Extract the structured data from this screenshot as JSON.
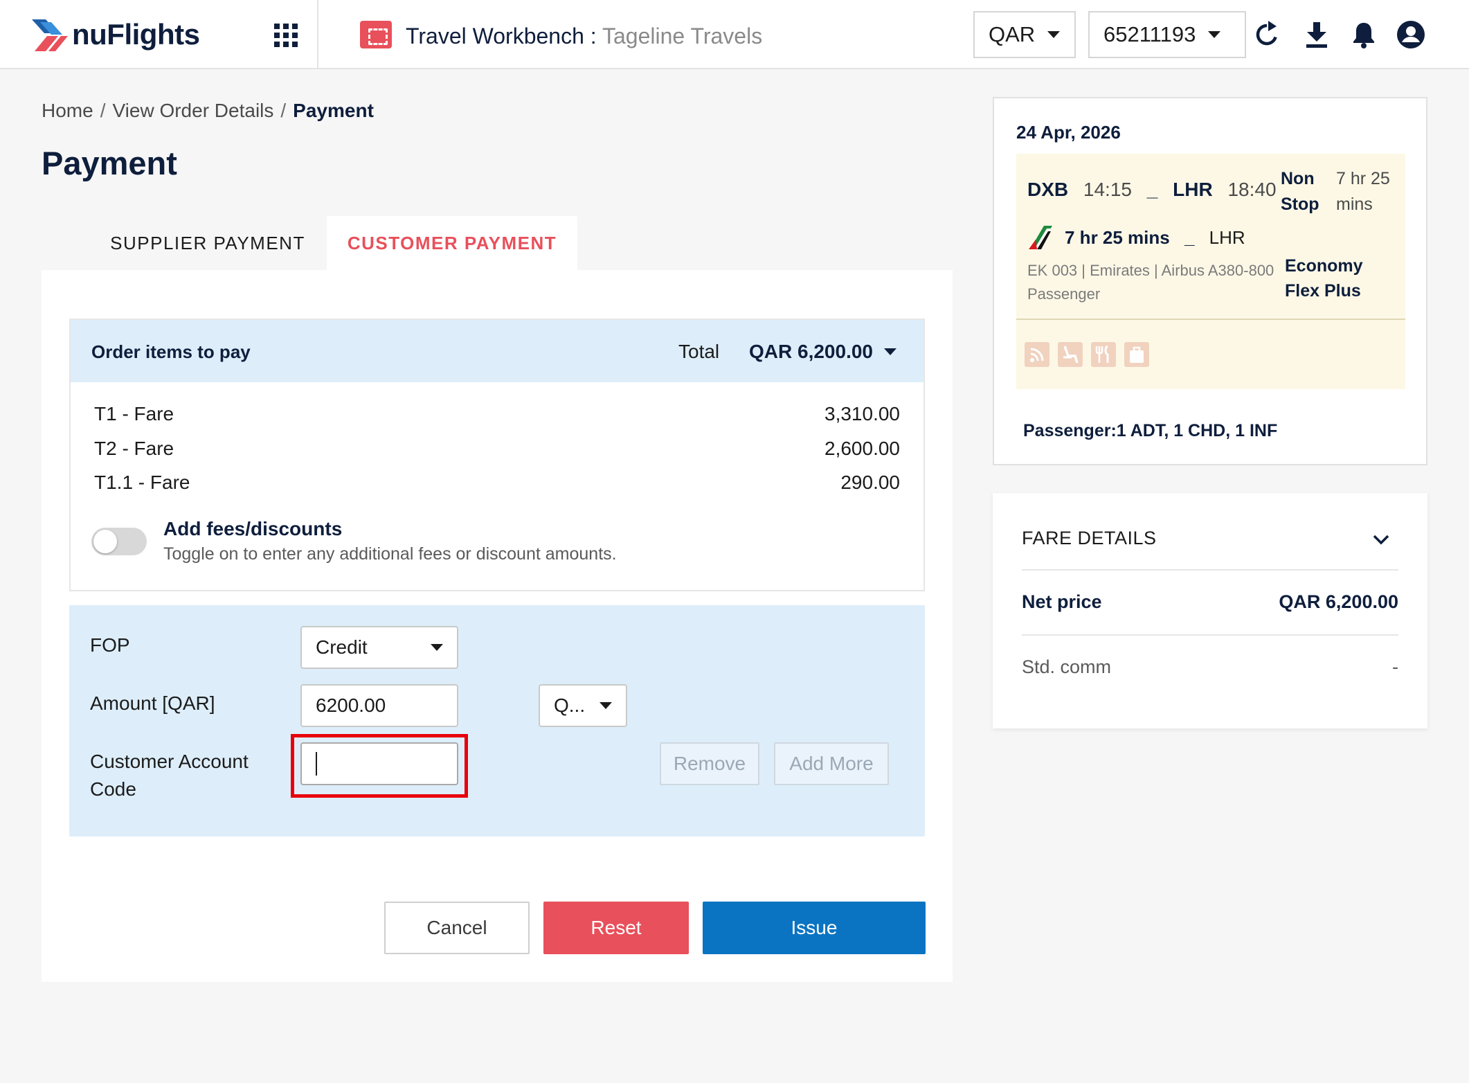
{
  "header": {
    "logo_text": "nuFlights",
    "workbench_title": "Travel Workbench :",
    "workbench_subtitle": "Tageline Travels",
    "currency": "QAR",
    "account_number": "65211193",
    "icons": [
      "apps-grid-icon",
      "ticket-icon",
      "refresh-icon",
      "download-icon",
      "bell-icon",
      "account-icon"
    ]
  },
  "breadcrumb": {
    "home": "Home",
    "order": "View Order Details",
    "current": "Payment",
    "separator": "/"
  },
  "page_title": "Payment",
  "tabs": {
    "supplier": "SUPPLIER PAYMENT",
    "customer": "CUSTOMER PAYMENT",
    "active": "customer"
  },
  "order_items": {
    "heading": "Order items to pay",
    "total_label": "Total",
    "total_value": "QAR 6,200.00",
    "items": [
      {
        "label": "T1  - Fare",
        "amount": "3,310.00"
      },
      {
        "label": "T2  - Fare",
        "amount": "2,600.00"
      },
      {
        "label": "T1.1  - Fare",
        "amount": "290.00"
      }
    ],
    "fees_toggle": {
      "title": "Add fees/discounts",
      "description": "Toggle on to enter any additional fees or discount amounts.",
      "on": false
    }
  },
  "payment_form": {
    "fop_label": "FOP",
    "fop_value": "Credit",
    "amount_label": "Amount [QAR]",
    "amount_value": "6200.00",
    "currency_select": "Q...",
    "account_code_label": "Customer Account Code",
    "account_code_value": "",
    "remove_label": "Remove",
    "add_more_label": "Add More"
  },
  "actions": {
    "cancel": "Cancel",
    "reset": "Reset",
    "issue": "Issue"
  },
  "flight": {
    "date": "24 Apr, 2026",
    "origin": "DXB",
    "departure_time": "14:15",
    "destination": "LHR",
    "arrival_time": "18:40",
    "dash": "_",
    "stops_line1": "Non",
    "stops_line2": "Stop",
    "duration_line1": "7 hr 25",
    "duration_line2": "mins",
    "segment_duration": "7 hr 25 mins",
    "segment_destination": "LHR",
    "flight_info": "EK 003 | Emirates | Airbus A380-800 Passenger",
    "cabin_line1": "Economy",
    "cabin_line2": "Flex Plus",
    "amenities": [
      "wifi-icon",
      "seat-icon",
      "meal-icon",
      "baggage-icon"
    ],
    "passengers": "Passenger:1 ADT, 1 CHD, 1 INF"
  },
  "fare_details": {
    "title": "FARE DETAILS",
    "net_price_label": "Net price",
    "net_price_value": "QAR 6,200.00",
    "std_comm_label": "Std. comm",
    "std_comm_value": "-"
  },
  "colors": {
    "brand_navy": "#0e1e3c",
    "accent_red": "#e8505b",
    "primary_blue": "#0a74c2",
    "highlight_box": "#e8000b",
    "panel_blue": "#ddeefa",
    "segment_cream": "#fdf8e6"
  }
}
